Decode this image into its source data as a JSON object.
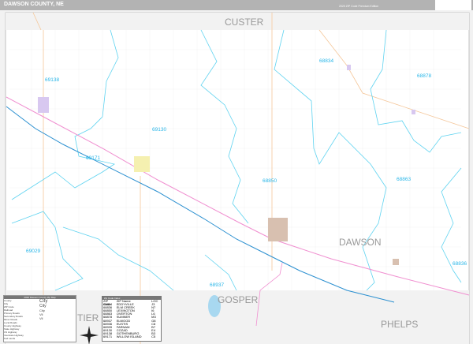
{
  "header": {
    "title": "DAWSON COUNTY, NE",
    "edition": "2020 ZIP Code Premium Edition",
    "logo_text": "MAPS"
  },
  "map": {
    "county_labels": [
      {
        "text": "CUSTER"
      },
      {
        "text": "DAWSON"
      },
      {
        "text": "GOSPER"
      },
      {
        "text": "PHELPS"
      },
      {
        "text": "TIER"
      }
    ],
    "zip_labels": [
      "69138",
      "69130",
      "68834",
      "68878",
      "69171",
      "68850",
      "68863",
      "69029",
      "68836",
      "68937"
    ],
    "colors": {
      "zip_boundary": "#5fd3f0",
      "interstate": "#2a8fd0",
      "highway": "#f08fd0",
      "road": "#f5c79a",
      "water": "#a8d8f0",
      "surrounding": "#f2f2f2"
    }
  },
  "legend": {
    "title": "2020 Dawson County Zip Map",
    "items": [
      "County",
      "City",
      "ZIP Code",
      "Railroad",
      "Primary Roads",
      "Secondary Roads",
      "Minor Roads",
      "Local Roads",
      "County Highway",
      "State Highway",
      "US Highway",
      "Interstate Highway",
      "Fed Lands"
    ],
    "city_labels": [
      "City",
      "City",
      "City",
      "Vil",
      "Vil"
    ]
  },
  "zip_table": {
    "title": "Zip Code Index",
    "headers": [
      "ZIP Code",
      "ZIP Name",
      "LOC"
    ],
    "rows": [
      [
        "68834",
        "EDDYVILLE",
        "J3"
      ],
      [
        "68836",
        "ELM CREEK",
        "N7"
      ],
      [
        "68850",
        "LEXINGTON",
        "I6"
      ],
      [
        "68863",
        "OVERTON",
        "L6"
      ],
      [
        "68878",
        "SUMNER",
        "M3"
      ],
      [
        "68937",
        "ELWOOD",
        "G8"
      ],
      [
        "68936",
        "EUSTIS",
        "C8"
      ],
      [
        "68939",
        "FARNAM",
        "B7"
      ],
      [
        "69130",
        "COZAD",
        "E4"
      ],
      [
        "69138",
        "GOTHENBURG",
        "B3"
      ],
      [
        "69171",
        "WILLOW ISLAND",
        "C5"
      ]
    ]
  }
}
